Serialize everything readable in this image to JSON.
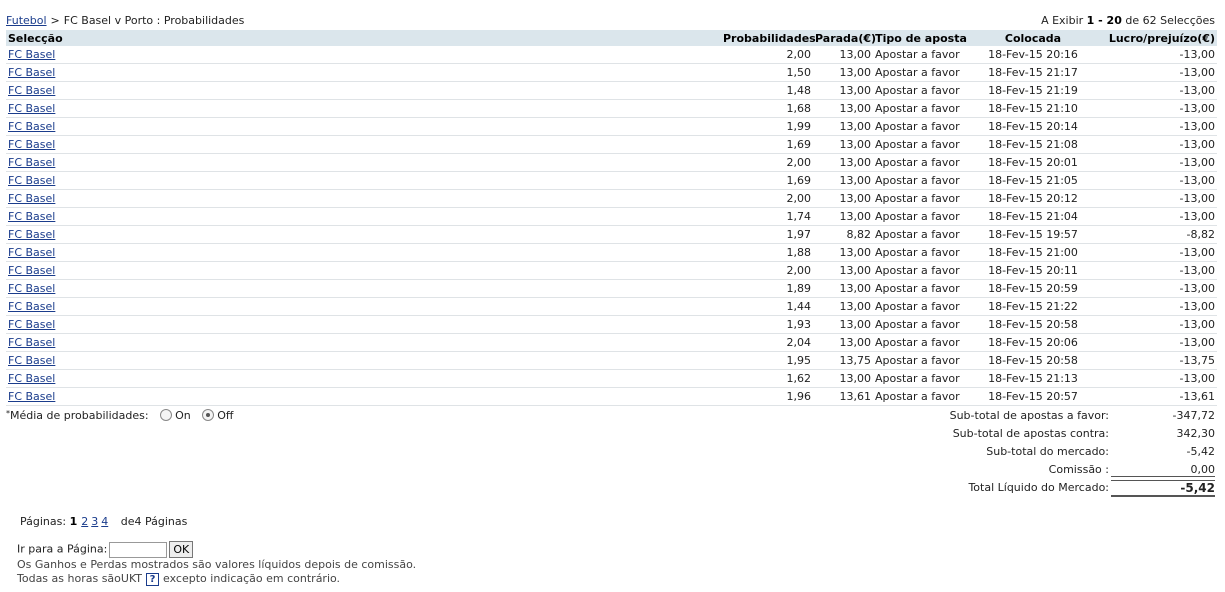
{
  "breadcrumb": {
    "sport_link": "Futebol",
    "separator": ">",
    "current": "FC Basel v Porto : Probabilidades"
  },
  "showing": {
    "prefix": "A Exibir",
    "range": "1 - 20",
    "suffix": "de 62 Selecções"
  },
  "table": {
    "headers": {
      "selection": "Selecção",
      "odds": "Probabilidades",
      "stake": "Parada(€)",
      "bet_type": "Tipo de aposta",
      "placed": "Colocada",
      "pl": "Lucro/prejuízo(€)"
    },
    "rows": [
      {
        "selection": "FC Basel",
        "odds": "2,00",
        "stake": "13,00",
        "type": "Apostar a favor",
        "placed": "18-Fev-15 20:16",
        "pl": "-13,00"
      },
      {
        "selection": "FC Basel",
        "odds": "1,50",
        "stake": "13,00",
        "type": "Apostar a favor",
        "placed": "18-Fev-15 21:17",
        "pl": "-13,00"
      },
      {
        "selection": "FC Basel",
        "odds": "1,48",
        "stake": "13,00",
        "type": "Apostar a favor",
        "placed": "18-Fev-15 21:19",
        "pl": "-13,00"
      },
      {
        "selection": "FC Basel",
        "odds": "1,68",
        "stake": "13,00",
        "type": "Apostar a favor",
        "placed": "18-Fev-15 21:10",
        "pl": "-13,00"
      },
      {
        "selection": "FC Basel",
        "odds": "1,99",
        "stake": "13,00",
        "type": "Apostar a favor",
        "placed": "18-Fev-15 20:14",
        "pl": "-13,00"
      },
      {
        "selection": "FC Basel",
        "odds": "1,69",
        "stake": "13,00",
        "type": "Apostar a favor",
        "placed": "18-Fev-15 21:08",
        "pl": "-13,00"
      },
      {
        "selection": "FC Basel",
        "odds": "2,00",
        "stake": "13,00",
        "type": "Apostar a favor",
        "placed": "18-Fev-15 20:01",
        "pl": "-13,00"
      },
      {
        "selection": "FC Basel",
        "odds": "1,69",
        "stake": "13,00",
        "type": "Apostar a favor",
        "placed": "18-Fev-15 21:05",
        "pl": "-13,00"
      },
      {
        "selection": "FC Basel",
        "odds": "2,00",
        "stake": "13,00",
        "type": "Apostar a favor",
        "placed": "18-Fev-15 20:12",
        "pl": "-13,00"
      },
      {
        "selection": "FC Basel",
        "odds": "1,74",
        "stake": "13,00",
        "type": "Apostar a favor",
        "placed": "18-Fev-15 21:04",
        "pl": "-13,00"
      },
      {
        "selection": "FC Basel",
        "odds": "1,97",
        "stake": "8,82",
        "type": "Apostar a favor",
        "placed": "18-Fev-15 19:57",
        "pl": "-8,82"
      },
      {
        "selection": "FC Basel",
        "odds": "1,88",
        "stake": "13,00",
        "type": "Apostar a favor",
        "placed": "18-Fev-15 21:00",
        "pl": "-13,00"
      },
      {
        "selection": "FC Basel",
        "odds": "2,00",
        "stake": "13,00",
        "type": "Apostar a favor",
        "placed": "18-Fev-15 20:11",
        "pl": "-13,00"
      },
      {
        "selection": "FC Basel",
        "odds": "1,89",
        "stake": "13,00",
        "type": "Apostar a favor",
        "placed": "18-Fev-15 20:59",
        "pl": "-13,00"
      },
      {
        "selection": "FC Basel",
        "odds": "1,44",
        "stake": "13,00",
        "type": "Apostar a favor",
        "placed": "18-Fev-15 21:22",
        "pl": "-13,00"
      },
      {
        "selection": "FC Basel",
        "odds": "1,93",
        "stake": "13,00",
        "type": "Apostar a favor",
        "placed": "18-Fev-15 20:58",
        "pl": "-13,00"
      },
      {
        "selection": "FC Basel",
        "odds": "2,04",
        "stake": "13,00",
        "type": "Apostar a favor",
        "placed": "18-Fev-15 20:06",
        "pl": "-13,00"
      },
      {
        "selection": "FC Basel",
        "odds": "1,95",
        "stake": "13,75",
        "type": "Apostar a favor",
        "placed": "18-Fev-15 20:58",
        "pl": "-13,75"
      },
      {
        "selection": "FC Basel",
        "odds": "1,62",
        "stake": "13,00",
        "type": "Apostar a favor",
        "placed": "18-Fev-15 21:13",
        "pl": "-13,00"
      },
      {
        "selection": "FC Basel",
        "odds": "1,96",
        "stake": "13,61",
        "type": "Apostar a favor",
        "placed": "18-Fev-15 20:57",
        "pl": "-13,61"
      }
    ]
  },
  "average": {
    "marker": "*",
    "label": "Média de probabilidades:",
    "on_label": "On",
    "off_label": "Off",
    "selected": "Off"
  },
  "totals": {
    "back_label": "Sub-total de apostas a favor:",
    "back_value": "-347,72",
    "lay_label": "Sub-total de apostas contra:",
    "lay_value": "342,30",
    "market_label": "Sub-total do mercado:",
    "market_value": "-5,42",
    "commission_label": "Comissão :",
    "commission_value": "0,00",
    "net_label": "Total Líquido do Mercado:",
    "net_value": "-5,42"
  },
  "pagination": {
    "label": "Páginas:",
    "current": "1",
    "pages": [
      "2",
      "3",
      "4"
    ],
    "of_text": "de4 Páginas"
  },
  "goto": {
    "label": "Ir para a Página:",
    "input_value": "",
    "button": "OK"
  },
  "notes": {
    "line1": "Os Ganhos e Perdas mostrados são valores líquidos depois de comissão.",
    "line2_prefix": "Todas as horas sãoUKT",
    "help_glyph": "?",
    "line2_suffix": "excepto indicação em contrário."
  },
  "colors": {
    "header_bg": "#dbe6ec",
    "link": "#1a3c8c",
    "row_border": "#dfe3e6"
  }
}
